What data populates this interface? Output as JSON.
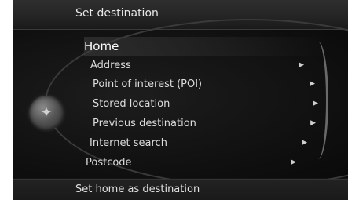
{
  "header": {
    "title": "Set destination"
  },
  "menu": {
    "items": [
      {
        "label": "Home",
        "arrow": ""
      },
      {
        "label": "Address",
        "arrow": "▶"
      },
      {
        "label": "Point of interest (POI)",
        "arrow": "▶"
      },
      {
        "label": "Stored location",
        "arrow": "▶"
      },
      {
        "label": "Previous destination",
        "arrow": "▶"
      },
      {
        "label": "Internet search",
        "arrow": "▶"
      },
      {
        "label": "Postcode",
        "arrow": "▶"
      }
    ],
    "selected_index": 0
  },
  "controls": {
    "knob_icon": "compass-star-icon",
    "knob_glyph": "✦"
  },
  "footer": {
    "text": "Set home as destination"
  },
  "colors": {
    "background": "#141414",
    "text": "#dcdcdc",
    "selected_text": "#ffffff"
  }
}
